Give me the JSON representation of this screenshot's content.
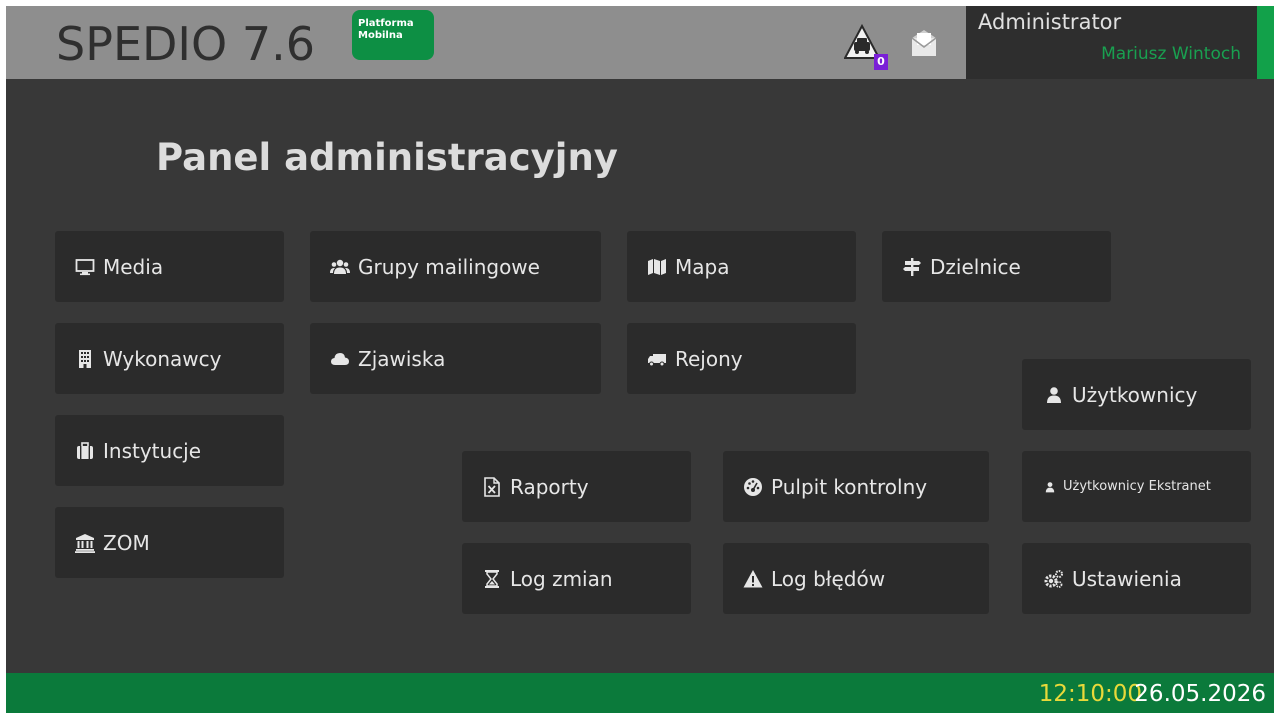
{
  "header": {
    "app_title": "SPEDIO 7.6",
    "badge_line1": "Platforma",
    "badge_line2": "Mobilna",
    "alert_count": "0",
    "user_role": "Administrator",
    "user_name": "Mariusz Wintoch"
  },
  "panel": {
    "title": "Panel administracyjny",
    "tiles": [
      {
        "label": "Media",
        "icon": "monitor-icon"
      },
      {
        "label": "Grupy mailingowe",
        "icon": "users-icon"
      },
      {
        "label": "Mapa",
        "icon": "map-icon"
      },
      {
        "label": "Dzielnice",
        "icon": "signpost-icon"
      },
      {
        "label": "Wykonawcy",
        "icon": "building-icon"
      },
      {
        "label": "Zjawiska",
        "icon": "cloud-icon"
      },
      {
        "label": "Rejony",
        "icon": "truck-icon"
      },
      {
        "label": "Użytkownicy",
        "icon": "user-icon"
      },
      {
        "label": "Instytucje",
        "icon": "suitcase-icon"
      },
      {
        "label": "Raporty",
        "icon": "excel-file-icon"
      },
      {
        "label": "Pulpit kontrolny",
        "icon": "dashboard-icon"
      },
      {
        "label": "Użytkownicy Ekstranet",
        "icon": "user-icon"
      },
      {
        "label": "ZOM",
        "icon": "bank-icon"
      },
      {
        "label": "Log zmian",
        "icon": "hourglass-icon"
      },
      {
        "label": "Log błędów",
        "icon": "warning-icon"
      },
      {
        "label": "Ustawienia",
        "icon": "cogs-icon"
      }
    ]
  },
  "footer": {
    "time": "12:10:00",
    "date": "26.05.2026"
  },
  "colors": {
    "background": "#383838",
    "header": "#8e8e8e",
    "tile": "#2b2b2b",
    "accent_green": "#0d8f44",
    "footer": "#0b7a3b",
    "clock_time": "#e8d93a"
  }
}
